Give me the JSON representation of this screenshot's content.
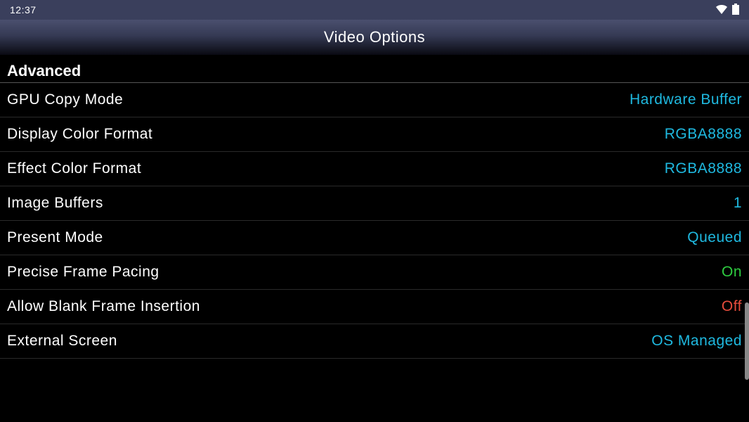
{
  "status": {
    "time": "12:37"
  },
  "title": "Video Options",
  "section": "Advanced",
  "options": [
    {
      "label": "GPU Copy Mode",
      "value": "Hardware Buffer",
      "kind": "cyan"
    },
    {
      "label": "Display Color Format",
      "value": "RGBA8888",
      "kind": "cyan"
    },
    {
      "label": "Effect Color Format",
      "value": "RGBA8888",
      "kind": "cyan"
    },
    {
      "label": "Image Buffers",
      "value": "1",
      "kind": "cyan"
    },
    {
      "label": "Present Mode",
      "value": "Queued",
      "kind": "cyan"
    },
    {
      "label": "Precise Frame Pacing",
      "value": "On",
      "kind": "green"
    },
    {
      "label": "Allow Blank Frame Insertion",
      "value": "Off",
      "kind": "red"
    },
    {
      "label": "External Screen",
      "value": "OS Managed",
      "kind": "cyan"
    }
  ]
}
